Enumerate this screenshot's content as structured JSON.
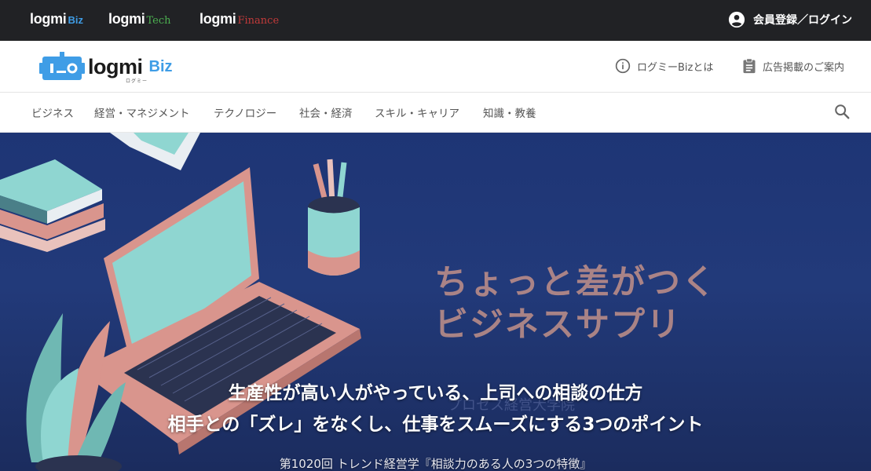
{
  "topbar": {
    "sites": [
      {
        "word": "logmi",
        "suffix": "Biz"
      },
      {
        "word": "logmi",
        "suffix": "Tech"
      },
      {
        "word": "logmi",
        "suffix": "Finance"
      }
    ],
    "login_label": "会員登録／ログイン"
  },
  "header": {
    "brand_word": "logmi",
    "brand_suffix": "Biz",
    "brand_kana": "ログミー",
    "about_label": "ログミーBizとは",
    "ads_label": "広告掲載のご案内"
  },
  "categories": [
    "ビジネス",
    "経営・マネジメント",
    "テクノロジー",
    "社会・経済",
    "スキル・キャリア",
    "知識・教養"
  ],
  "hero": {
    "catch_line1": "ちょっと差がつく",
    "catch_line2": "ビジネスサプリ",
    "watermark": "プロセス経営大学院",
    "title_line1": "生産性が高い人がやっている、上司への相談の仕方",
    "title_line2": "相手との「ズレ」をなくし、仕事をスムーズにする3つのポイント",
    "subtitle": "第1020回 トレンド経営学『相談力のある人の3つの特徴』"
  },
  "colors": {
    "topbar_bg": "#212225",
    "biz_blue": "#3f9de6",
    "tech_green": "#4caf50",
    "finance_red": "#c23a3a",
    "hero_bg": "#1e3575"
  },
  "icons": [
    "account-circle-icon",
    "info-icon",
    "clipboard-icon",
    "search-icon",
    "robot-logo-icon"
  ]
}
